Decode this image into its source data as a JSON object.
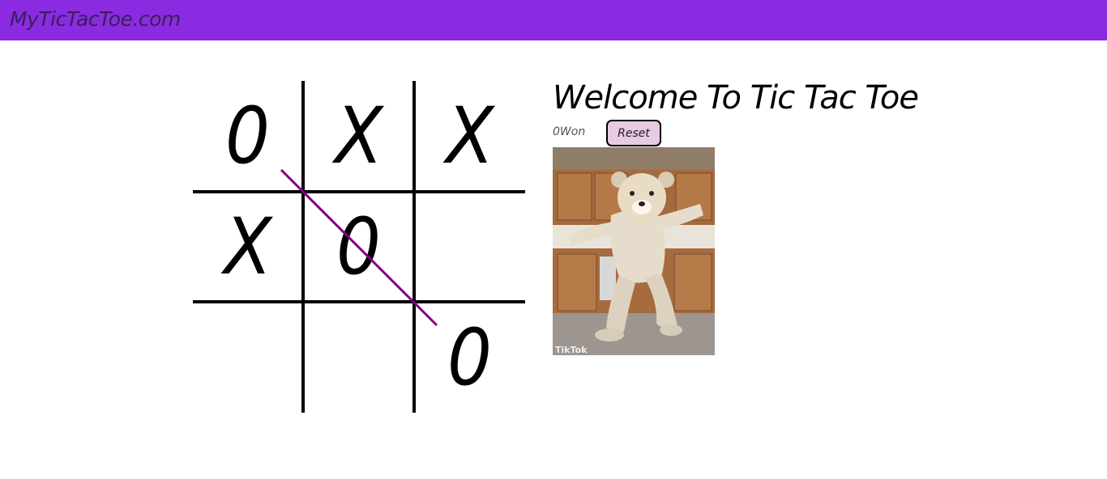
{
  "navbar": {
    "brand": "MyTicTacToe.com",
    "background": "#8a2be2"
  },
  "game": {
    "board": [
      [
        "0",
        "X",
        "X"
      ],
      [
        "X",
        "0",
        ""
      ],
      [
        "",
        "",
        "0"
      ]
    ],
    "winning_line": {
      "from_cell": [
        0,
        0
      ],
      "to_cell": [
        2,
        2
      ],
      "color": "#800080"
    },
    "title": "Welcome To Tic Tac Toe",
    "status": "0Won",
    "reset_label": "Reset",
    "reset_color": "#e6cbe3",
    "gif_watermark": "TikTok"
  }
}
